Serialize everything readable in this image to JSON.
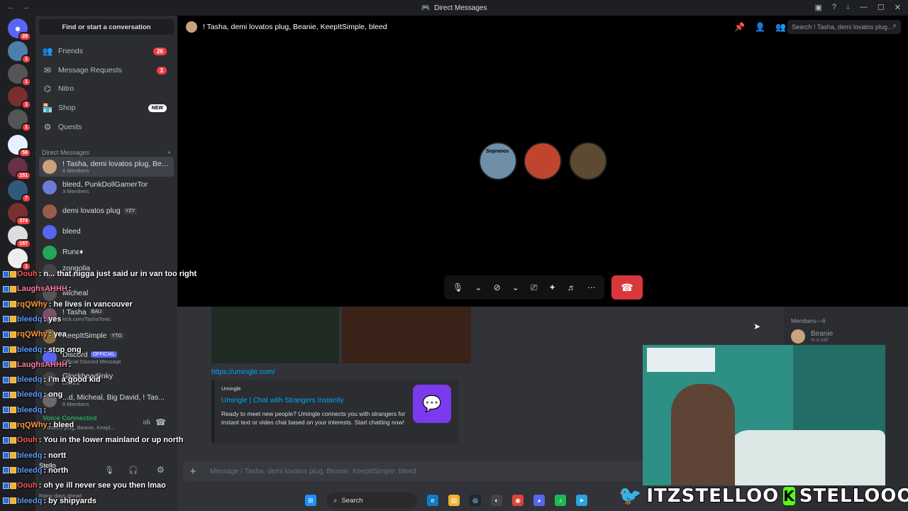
{
  "window": {
    "title": "Direct Messages"
  },
  "sidebar": {
    "find_placeholder": "Find or start a conversation",
    "nav": [
      {
        "label": "Friends",
        "badge": "26"
      },
      {
        "label": "Message Requests",
        "badge": "3"
      },
      {
        "label": "Nitro"
      },
      {
        "label": "Shop",
        "badge": "NEW"
      },
      {
        "label": "Quests"
      }
    ],
    "dm_header": "Direct Messages",
    "dms": [
      {
        "name": "! Tasha, demi lovatos plug, Bean...",
        "sub": "6 Members"
      },
      {
        "name": "bleed, PunkDollGamerTor",
        "sub": "3 Members"
      },
      {
        "name": "demi lovatos plug",
        "tag": "YZY"
      },
      {
        "name": "bleed"
      },
      {
        "name": "Runε♦"
      },
      {
        "name": "zongolia",
        "sub": "VALORANT"
      },
      {
        "name": "Micheal"
      },
      {
        "name": "! Tasha",
        "tag": "BAU",
        "sub": "kick.com/TashaToxic"
      },
      {
        "name": "KeepItSimple",
        "tag": "YTG"
      },
      {
        "name": "Discord",
        "tag": "OFFICIAL",
        "sub": "Official Discord Message"
      },
      {
        "name": "Glockheadjinky",
        "sub": "Legacy"
      },
      {
        "name": "...d, Micheal, Big David, ! Tas...",
        "sub": "8 Members"
      }
    ],
    "voice": {
      "status": "Voice Connected",
      "channel": "...ovatos plug, Beanie, Keepl..."
    },
    "user": {
      "name": "Stello",
      "status": "Rainy days ahead"
    }
  },
  "servers": [
    "28",
    "1",
    "1",
    "1",
    "1",
    "58",
    "151",
    "7",
    "374",
    "187",
    "1",
    "101",
    "15",
    "18"
  ],
  "topbar": {
    "channel": "! Tasha, demi lovatos plug, Beanie, KeepItSimple, bleed",
    "search_placeholder": "Search ! Tasha, demi lovatos plug..."
  },
  "call": {
    "avatar_labels": [
      "Sopranos"
    ]
  },
  "chat": {
    "link": "https://umingle.com/",
    "embed": {
      "provider": "Umingle",
      "title": "Umingle | Chat with Strangers Instantly",
      "description": "Ready to meet new people? Umingle connects you with strangers for instant text or video chat based on your interests. Start chatting now!"
    },
    "input_placeholder": "Message ! Tasha, demi lovatos plug, Beanie, KeepItSimple, bleed"
  },
  "members": {
    "header": "Members—6",
    "first": {
      "name": "Beanie",
      "status": "In a call"
    }
  },
  "stream_chat": [
    {
      "user": "Oouh",
      "color": "#ff5a5a",
      "text": ": n... that nigga just said ur in van too right"
    },
    {
      "user": "LaughsAHHH",
      "color": "#ff7aa0",
      "text": ":"
    },
    {
      "user": "rqQWhy",
      "color": "#ff9a3c",
      "text": ": he lives in vancouver"
    },
    {
      "user": "bleedq",
      "color": "#5a9cff",
      "text": ": yes"
    },
    {
      "user": "rqQWhy",
      "color": "#ff9a3c",
      "text": ": yea"
    },
    {
      "user": "bleedq",
      "color": "#5a9cff",
      "text": ": stop ong"
    },
    {
      "user": "LaughsAHHH",
      "color": "#ff7aa0",
      "text": ":"
    },
    {
      "user": "bleedq",
      "color": "#5a9cff",
      "text": ": i'm a good kid"
    },
    {
      "user": "bleedq",
      "color": "#5a9cff",
      "text": ": ong"
    },
    {
      "user": "bleedq",
      "color": "#5a9cff",
      "text": ":"
    },
    {
      "user": "rqQWhy",
      "color": "#ff9a3c",
      "text": ": bleed"
    },
    {
      "user": "Oouh",
      "color": "#ff5a5a",
      "text": ": You in the lower mainland or up north"
    },
    {
      "user": "bleedq",
      "color": "#5a9cff",
      "text": ": nortt"
    },
    {
      "user": "bleedq",
      "color": "#5a9cff",
      "text": ": north"
    },
    {
      "user": "Oouh",
      "color": "#ff5a5a",
      "text": ": oh ye ill never see you then lmao"
    },
    {
      "user": "bleedq",
      "color": "#5a9cff",
      "text": ": by shipyards"
    }
  ],
  "taskbar": {
    "search": "Search"
  },
  "brand": {
    "twitter": "ITZSTELLOO",
    "kick": "STELLOOO"
  }
}
